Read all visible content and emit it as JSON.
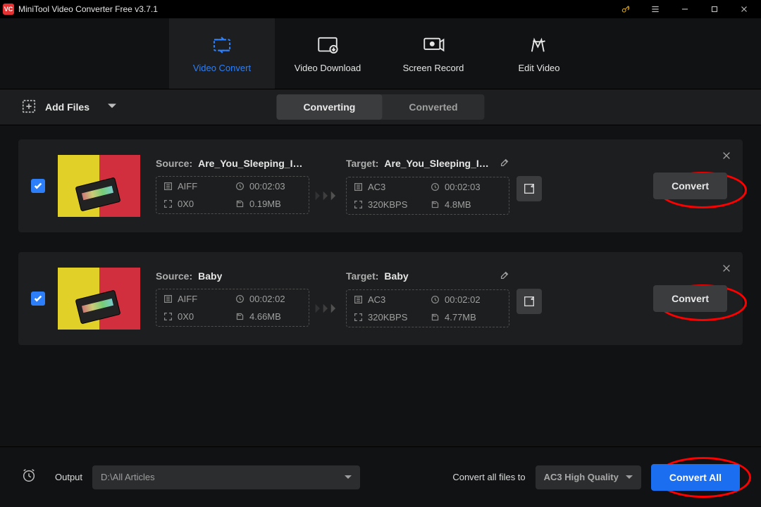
{
  "app": {
    "title": "MiniTool Video Converter Free v3.7.1",
    "logo_text": "VC"
  },
  "nav": {
    "items": [
      {
        "label": "Video Convert"
      },
      {
        "label": "Video Download"
      },
      {
        "label": "Screen Record"
      },
      {
        "label": "Edit Video"
      }
    ]
  },
  "toolbar": {
    "add_files_label": "Add Files",
    "converting_label": "Converting",
    "converted_label": "Converted"
  },
  "items": [
    {
      "source_label": "Source:",
      "source_name": "Are_You_Sleeping_In...",
      "target_label": "Target:",
      "target_name": "Are_You_Sleeping_In...",
      "src_codec": "AIFF",
      "src_duration": "00:02:03",
      "src_res": "0X0",
      "src_size": "0.19MB",
      "tgt_codec": "AC3",
      "tgt_duration": "00:02:03",
      "tgt_bitrate": "320KBPS",
      "tgt_size": "4.8MB",
      "convert_label": "Convert"
    },
    {
      "source_label": "Source:",
      "source_name": "Baby",
      "target_label": "Target:",
      "target_name": "Baby",
      "src_codec": "AIFF",
      "src_duration": "00:02:02",
      "src_res": "0X0",
      "src_size": "4.66MB",
      "tgt_codec": "AC3",
      "tgt_duration": "00:02:02",
      "tgt_bitrate": "320KBPS",
      "tgt_size": "4.77MB",
      "convert_label": "Convert"
    }
  ],
  "bottom": {
    "output_label": "Output",
    "output_path": "D:\\All Articles",
    "convert_all_files_to_label": "Convert all files to",
    "format_label": "AC3 High Quality",
    "convert_all_button": "Convert All"
  }
}
